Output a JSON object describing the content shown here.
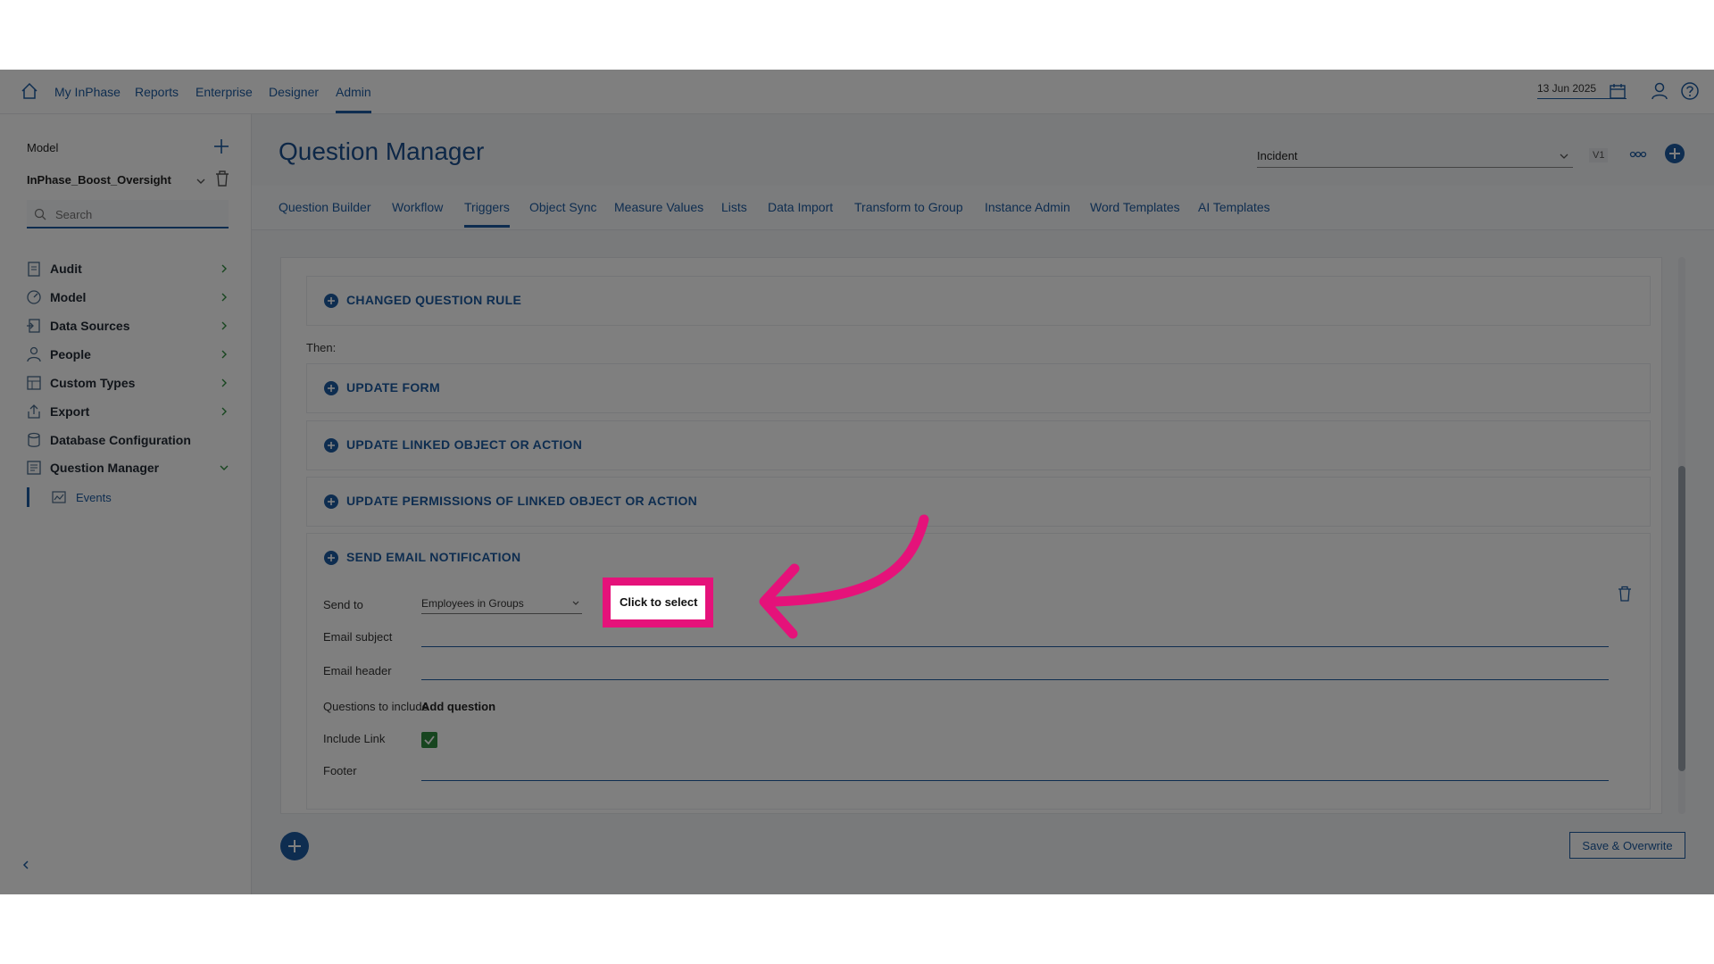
{
  "nav": {
    "items": [
      "My InPhase",
      "Reports",
      "Enterprise",
      "Designer",
      "Admin"
    ],
    "active": "Admin"
  },
  "header_right": {
    "date": "13 Jun 2025"
  },
  "sidebar": {
    "model_label": "Model",
    "model_name": "InPhase_Boost_Oversight",
    "search_placeholder": "Search",
    "items": [
      {
        "label": "Audit",
        "icon": "audit-icon"
      },
      {
        "label": "Model",
        "icon": "model-icon"
      },
      {
        "label": "Data Sources",
        "icon": "data-sources-icon"
      },
      {
        "label": "People",
        "icon": "people-icon"
      },
      {
        "label": "Custom Types",
        "icon": "custom-types-icon"
      },
      {
        "label": "Export",
        "icon": "export-icon"
      },
      {
        "label": "Database Configuration",
        "icon": "database-icon"
      },
      {
        "label": "Question Manager",
        "icon": "question-manager-icon"
      }
    ],
    "sub_item": "Events"
  },
  "page": {
    "title": "Question Manager",
    "type_select": "Incident",
    "version": "V1"
  },
  "tabs": [
    "Question Builder",
    "Workflow",
    "Triggers",
    "Object Sync",
    "Measure Values",
    "Lists",
    "Data Import",
    "Transform to Group",
    "Instance Admin",
    "Word Templates",
    "AI Templates"
  ],
  "active_tab": "Triggers",
  "trigger": {
    "rule_section": "CHANGED QUESTION RULE",
    "then_label": "Then:",
    "actions": [
      "UPDATE FORM",
      "UPDATE LINKED OBJECT OR ACTION",
      "UPDATE PERMISSIONS OF LINKED OBJECT OR ACTION",
      "SEND EMAIL NOTIFICATION"
    ],
    "email": {
      "send_to_label": "Send to",
      "send_to_value": "Employees in Groups",
      "subject_label": "Email subject",
      "header_label": "Email header",
      "questions_label": "Questions to include",
      "add_question": "Add question",
      "include_link_label": "Include Link",
      "include_link_checked": true,
      "footer_label": "Footer"
    }
  },
  "footer": {
    "save_label": "Save & Overwrite"
  },
  "overlay": {
    "callout": "Click to select",
    "highlight_color": "#e5127a"
  },
  "colors": {
    "accent": "#1c5aa0",
    "check": "#2e8b3e"
  }
}
